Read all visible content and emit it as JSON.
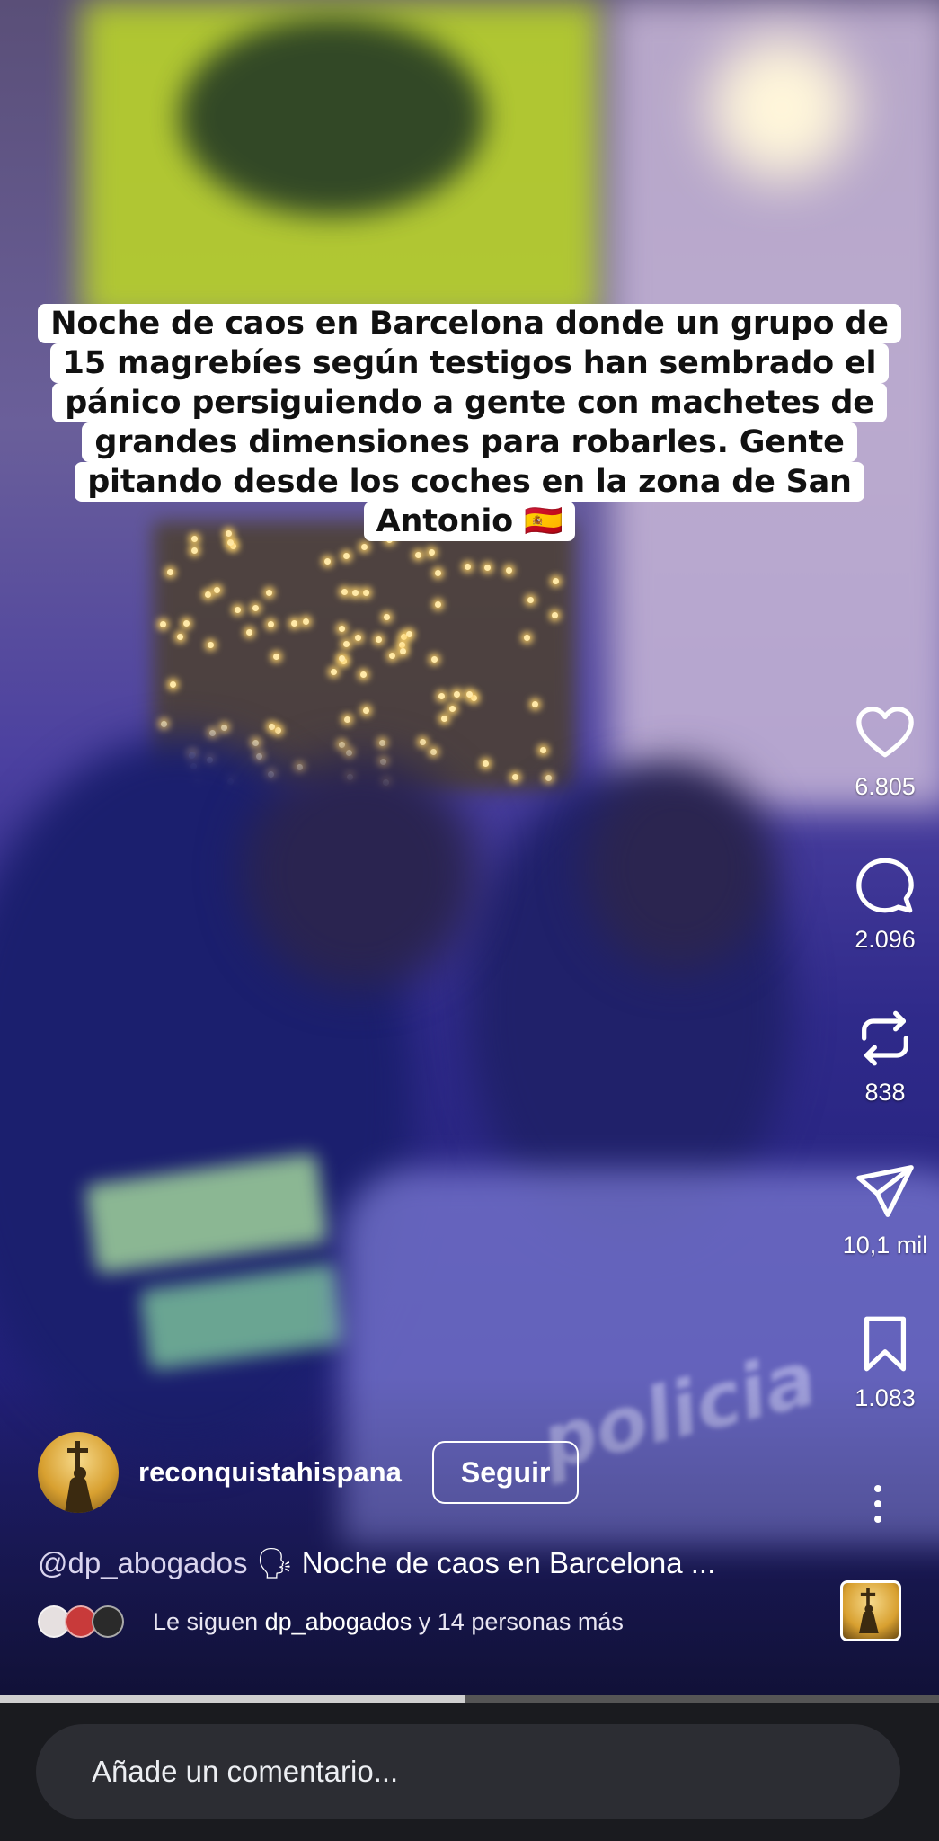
{
  "caption": {
    "lines": [
      "Noche de caos en Barcelona donde un grupo de",
      "15 magrebíes según testigos han sembrado el",
      "pánico persiguiendo  a gente con machetes de",
      "grandes dimensiones para robarles. Gente",
      "pitando desde los coches en la zona de San",
      "Antonio"
    ],
    "flag": "🇪🇸"
  },
  "video_text": "policia",
  "actions": {
    "like": {
      "icon": "heart-icon",
      "count": "6.805"
    },
    "comment": {
      "icon": "comment-bubble-icon",
      "count": "2.096"
    },
    "repost": {
      "icon": "repost-icon",
      "count": "838"
    },
    "share": {
      "icon": "send-icon",
      "count": "10,1 mil"
    },
    "save": {
      "icon": "bookmark-icon",
      "count": "1.083"
    }
  },
  "author": {
    "username": "reconquistahispana",
    "follow_label": "Seguir"
  },
  "description": {
    "mention": "@dp_abogados",
    "icon": "speaking-head-icon",
    "text": "Noche de caos en Barcelona ..."
  },
  "followers": {
    "prefix": "Le siguen ",
    "name": "dp_abogados",
    "suffix": " y 14 personas más"
  },
  "progress": {
    "fraction": 0.495
  },
  "comment": {
    "placeholder": "Añade un comentario..."
  },
  "colors": {
    "follow_border": "#ffffff",
    "comment_bar_bg": "#1a1b1f",
    "comment_input_bg": "#2c2d33"
  }
}
